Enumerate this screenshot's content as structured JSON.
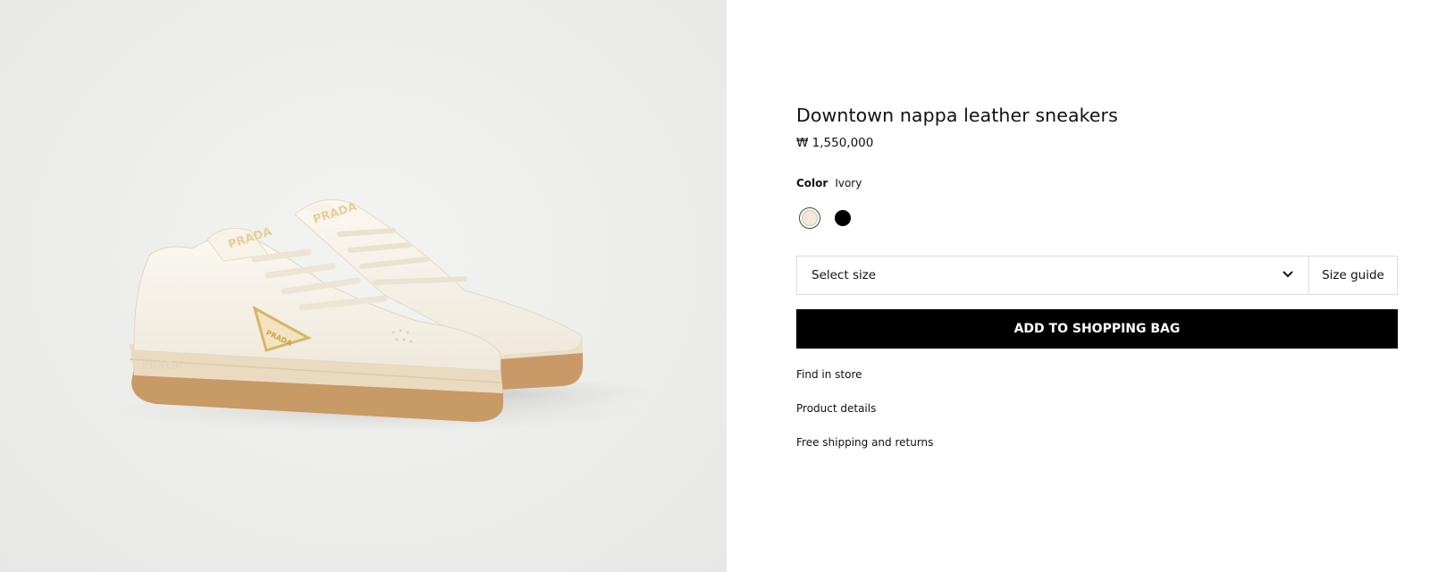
{
  "product": {
    "title": "Downtown nappa leather sneakers",
    "price": "₩ 1,550,000"
  },
  "color": {
    "label": "Color",
    "selected_value": "Ivory",
    "swatches": [
      {
        "name": "Ivory",
        "hex": "#f3ead8",
        "selected": true
      },
      {
        "name": "Black",
        "hex": "#000000",
        "selected": false
      }
    ]
  },
  "size": {
    "select_label": "Select size",
    "guide_label": "Size guide"
  },
  "actions": {
    "add_to_bag": "ADD TO SHOPPING BAG"
  },
  "links": {
    "find_in_store": "Find in store",
    "product_details": "Product details",
    "shipping": "Free shipping and returns"
  },
  "image": {
    "logo_text": "PRADA"
  }
}
